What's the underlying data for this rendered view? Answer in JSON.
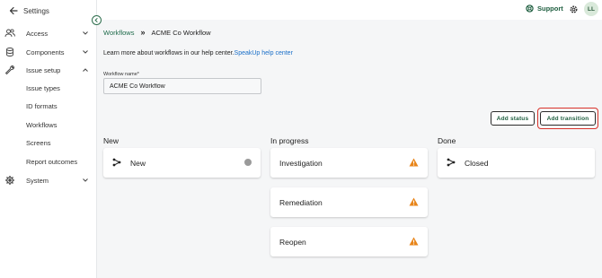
{
  "sidebar": {
    "header": "Settings",
    "items": [
      {
        "label": "Access",
        "icon": "people-icon",
        "expanded": false
      },
      {
        "label": "Components",
        "icon": "database-icon",
        "expanded": false
      },
      {
        "label": "Issue setup",
        "icon": "wrench-icon",
        "expanded": true
      },
      {
        "label": "System",
        "icon": "gear-icon",
        "expanded": false
      }
    ],
    "subitems": [
      "Issue types",
      "ID formats",
      "Workflows",
      "Screens",
      "Report outcomes"
    ]
  },
  "topbar": {
    "support_label": "Support",
    "avatar_initials": "LL"
  },
  "breadcrumb": {
    "parent": "Workflows",
    "current": "ACME Co Workflow"
  },
  "help": {
    "text": "Learn more about workflows in our help center.",
    "link": "SpeakUp help center"
  },
  "form": {
    "label": "Workflow name*",
    "value": "ACME Co Workflow"
  },
  "actions": {
    "add_status": "Add status",
    "add_transition": "Add transition"
  },
  "columns": [
    {
      "title": "New",
      "cards": [
        {
          "name": "New",
          "status": "dot"
        }
      ]
    },
    {
      "title": "In progress",
      "cards": [
        {
          "name": "Investigation",
          "status": "warning"
        },
        {
          "name": "Remediation",
          "status": "warning"
        },
        {
          "name": "Reopen",
          "status": "warning"
        }
      ]
    },
    {
      "title": "Done",
      "cards": [
        {
          "name": "Closed",
          "status": "none"
        }
      ]
    }
  ],
  "colors": {
    "brand_green": "#1e5e3f",
    "link_blue": "#1a6fc8",
    "warning_orange": "#e8851a",
    "highlight_red": "#d9322b"
  }
}
